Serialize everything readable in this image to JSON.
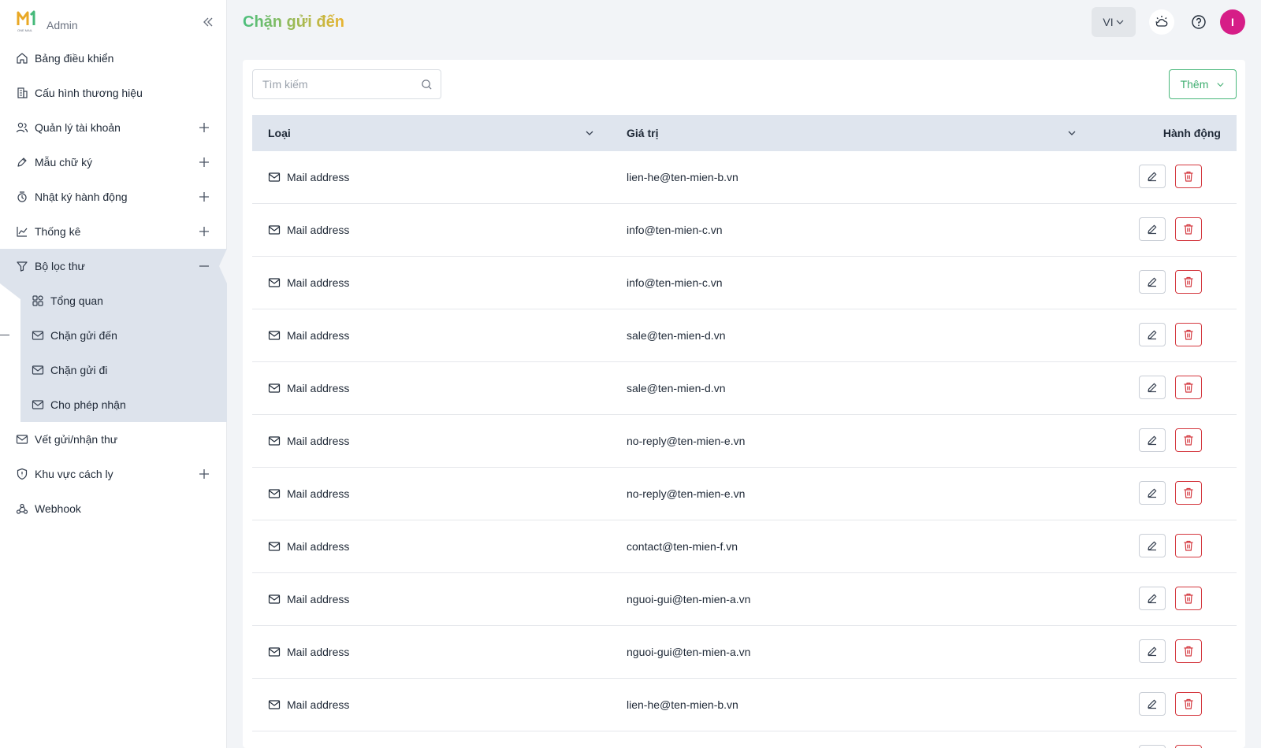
{
  "sidebar": {
    "brand": "Admin",
    "logo_caption": "ONE MAIL",
    "items": [
      {
        "label": "Bảng điều khiển",
        "icon": "home-icon"
      },
      {
        "label": "Cấu hình thương hiệu",
        "icon": "building-icon"
      },
      {
        "label": "Quản lý tài khoản",
        "icon": "users-icon",
        "expand": "plus"
      },
      {
        "label": "Mẫu chữ ký",
        "icon": "pen-icon",
        "expand": "plus"
      },
      {
        "label": "Nhật ký hành động",
        "icon": "history-icon",
        "expand": "plus"
      },
      {
        "label": "Thống kê",
        "icon": "chart-icon",
        "expand": "plus"
      },
      {
        "label": "Bộ lọc thư",
        "icon": "filter-icon",
        "expand": "minus",
        "active": true
      }
    ],
    "sub_items": [
      {
        "label": "Tổng quan",
        "icon": "grid-icon"
      },
      {
        "label": "Chặn gửi đến",
        "icon": "mail-block-icon",
        "current": true
      },
      {
        "label": "Chặn gửi đi",
        "icon": "mail-out-icon"
      },
      {
        "label": "Cho phép nhận",
        "icon": "mail-check-icon"
      }
    ],
    "items_after": [
      {
        "label": "Vết gửi/nhận thư",
        "icon": "mail-icon"
      },
      {
        "label": "Khu vực cách ly",
        "icon": "shield-icon",
        "expand": "plus"
      },
      {
        "label": "Webhook",
        "icon": "webhook-icon"
      }
    ]
  },
  "header": {
    "title": "Chặn gửi đến",
    "lang": "VI",
    "avatar_initial": "I"
  },
  "toolbar": {
    "search_placeholder": "Tìm kiếm",
    "add_label": "Thêm"
  },
  "table": {
    "columns": {
      "type": "Loại",
      "value": "Giá trị",
      "action": "Hành động"
    },
    "rows": [
      {
        "type": "Mail address",
        "value": "lien-he@ten-mien-b.vn"
      },
      {
        "type": "Mail address",
        "value": "info@ten-mien-c.vn"
      },
      {
        "type": "Mail address",
        "value": "info@ten-mien-c.vn"
      },
      {
        "type": "Mail address",
        "value": "sale@ten-mien-d.vn"
      },
      {
        "type": "Mail address",
        "value": "sale@ten-mien-d.vn"
      },
      {
        "type": "Mail address",
        "value": "no-reply@ten-mien-e.vn"
      },
      {
        "type": "Mail address",
        "value": "no-reply@ten-mien-e.vn"
      },
      {
        "type": "Mail address",
        "value": "contact@ten-mien-f.vn"
      },
      {
        "type": "Mail address",
        "value": "nguoi-gui@ten-mien-a.vn"
      },
      {
        "type": "Mail address",
        "value": "nguoi-gui@ten-mien-a.vn"
      },
      {
        "type": "Mail address",
        "value": "lien-he@ten-mien-b.vn"
      },
      {
        "type": "",
        "value": ""
      }
    ]
  },
  "colors": {
    "accent_green": "#3fae70",
    "danger_red": "#d4383f",
    "avatar_pink": "#d61d87",
    "active_bg": "#dde3ec"
  }
}
